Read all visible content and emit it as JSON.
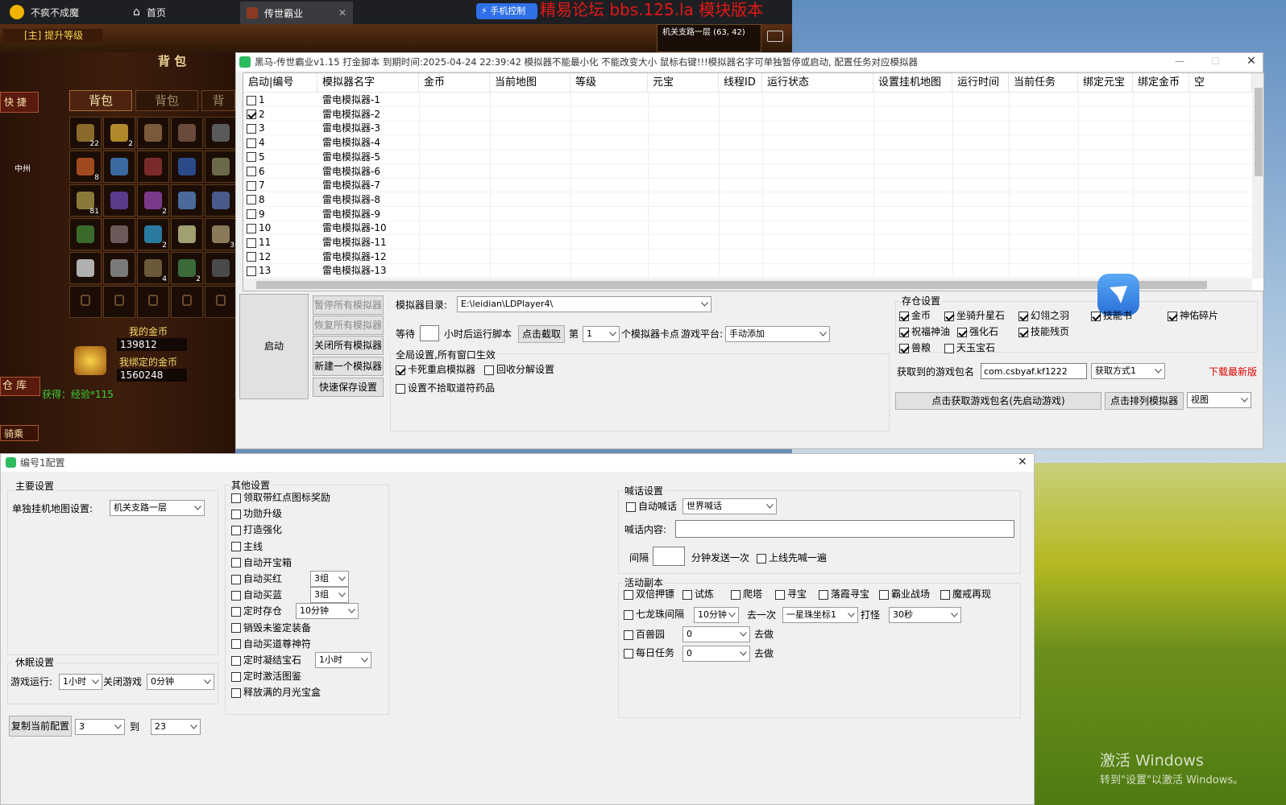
{
  "browser_tabs": {
    "tab1": "不疯不成魔",
    "tab2": "首页",
    "tab3": "传世霸业",
    "phone_control": "手机控制",
    "watermark": "精易论坛 bbs.125.la 模块版本"
  },
  "game": {
    "quest": "[主] 提升等级",
    "bag_title": "背 包",
    "quick": "快 捷",
    "tabs": [
      "背包",
      "背包",
      "背"
    ],
    "zhongzhou": "中州",
    "my_gold_label": "我的金币",
    "my_gold": "139812",
    "bound_gold_label": "我绑定的金币",
    "bound_gold": "1560248",
    "warehouse": "仓 库",
    "gain": "获得：经验*115",
    "mount": "骑乘",
    "map_info": "机关支路一层 (63, 42)",
    "item_counts": [
      "22",
      "2",
      "",
      "",
      "",
      "8",
      "",
      "",
      "",
      "",
      "81",
      "",
      "2",
      "",
      "",
      "",
      "",
      "2",
      "",
      "3",
      "",
      "",
      "4",
      "2",
      ""
    ]
  },
  "main_window": {
    "title": "黑马-传世霸业v1.15 打金脚本 到期时间:2025-04-24 22:39:42  模拟器不能最小化 不能改变大小 鼠标右键!!!模拟器名字可单独暂停或启动, 配置任务对应模拟器",
    "columns": [
      "启动|编号",
      "模拟器名字",
      "金币",
      "当前地图",
      "等级",
      "元宝",
      "线程ID",
      "运行状态",
      "设置挂机地图",
      "运行时间",
      "当前任务",
      "绑定元宝",
      "绑定金币",
      "空"
    ],
    "rows": [
      {
        "no": "1",
        "name": "雷电模拟器-1",
        "checked": false
      },
      {
        "no": "2",
        "name": "雷电模拟器-2",
        "checked": true
      },
      {
        "no": "3",
        "name": "雷电模拟器-3",
        "checked": false
      },
      {
        "no": "4",
        "name": "雷电模拟器-4",
        "checked": false
      },
      {
        "no": "5",
        "name": "雷电模拟器-5",
        "checked": false
      },
      {
        "no": "6",
        "name": "雷电模拟器-6",
        "checked": false
      },
      {
        "no": "7",
        "name": "雷电模拟器-7",
        "checked": false
      },
      {
        "no": "8",
        "name": "雷电模拟器-8",
        "checked": false
      },
      {
        "no": "9",
        "name": "雷电模拟器-9",
        "checked": false
      },
      {
        "no": "10",
        "name": "雷电模拟器-10",
        "checked": false
      },
      {
        "no": "11",
        "name": "雷电模拟器-11",
        "checked": false
      },
      {
        "no": "12",
        "name": "雷电模拟器-12",
        "checked": false
      },
      {
        "no": "13",
        "name": "雷电模拟器-13",
        "checked": false
      }
    ],
    "start": "启动",
    "pause_all": "暂停所有模拟器",
    "resume_all": "恢复所有模拟器",
    "close_all": "关闭所有模拟器",
    "new_one": "新建一个模拟器",
    "quick_save": "快速保存设置",
    "dir_label": "模拟器目录:",
    "dir_value": "E:\\leidian\\LDPlayer4\\",
    "wait_label": "等待",
    "wait_hours": "小时后运行脚本",
    "capture": "点击截取",
    "nth_label": "第",
    "nth_value": "1",
    "nth_suffix": "个模拟器卡点",
    "platform_label": "游戏平台:",
    "platform_value": "手动添加",
    "global_title": "全局设置,所有窗口生效",
    "g_restart": "卡死重启模拟器",
    "g_recycle": "回收分解设置",
    "g_nopick": "设置不拾取道符药品",
    "storage_title": "存仓设置",
    "storage": [
      {
        "label": "金币",
        "checked": true
      },
      {
        "label": "坐骑升星石",
        "checked": true
      },
      {
        "label": "幻翎之羽",
        "checked": true
      },
      {
        "label": "技能书",
        "checked": true
      },
      {
        "label": "神佑碎片",
        "checked": true
      },
      {
        "label": "祝福神油",
        "checked": true
      },
      {
        "label": "强化石",
        "checked": true
      },
      {
        "label": "技能残页",
        "checked": true
      },
      {
        "label": "兽粮",
        "checked": true
      },
      {
        "label": "天玉宝石",
        "checked": false
      }
    ],
    "pkg_label": "获取到的游戏包名",
    "pkg_value": "com.csbyaf.kf1222",
    "pkg_method": "获取方式1",
    "download": "下载最新版",
    "get_pkg": "点击获取游戏包名(先启动游戏)",
    "arrange": "点击排列模拟器",
    "view": "视图"
  },
  "config_window": {
    "title": "编号1配置",
    "main_title": "主要设置",
    "map_label": "单独挂机地图设置:",
    "map_value": "机关支路一层",
    "sleep_title": "休眠设置",
    "run_label": "游戏运行:",
    "run_value": "1小时",
    "close_label": "关闭游戏",
    "close_value": "0分钟",
    "copy_btn": "复制当前配置",
    "copy_from": "3",
    "to_label": "到",
    "copy_to": "23",
    "other_title": "其他设置",
    "other": [
      {
        "label": "领取带红点图标奖励",
        "sel": ""
      },
      {
        "label": "功勋升级",
        "sel": ""
      },
      {
        "label": "打造强化",
        "sel": ""
      },
      {
        "label": "主线",
        "sel": ""
      },
      {
        "label": "自动开宝箱",
        "sel": ""
      },
      {
        "label": "自动买红",
        "sel": "3组"
      },
      {
        "label": "自动买蓝",
        "sel": "3组"
      },
      {
        "label": "定时存仓",
        "sel": "10分钟"
      },
      {
        "label": "销毁未鉴定装备",
        "sel": ""
      },
      {
        "label": "自动买道尊神符",
        "sel": ""
      },
      {
        "label": "定时凝结宝石",
        "sel": "1小时"
      },
      {
        "label": "定时激活图鉴",
        "sel": ""
      },
      {
        "label": "释放满的月光宝盒",
        "sel": ""
      }
    ],
    "shout_title": "喊话设置",
    "auto_shout": "自动喊话",
    "shout_channel": "世界喊话",
    "shout_content_label": "喊话内容:",
    "interval_label": "间隔",
    "interval_suffix": "分钟发送一次",
    "online_shout": "上线先喊一遍",
    "activity_title": "活动副本",
    "act_row1": [
      "双倍押镖",
      "试炼",
      "爬塔",
      "寻宝",
      "落霞寻宝",
      "霸业战场",
      "魔戒再现"
    ],
    "dragon": "七龙珠间隔",
    "dragon_sel": "10分钟",
    "go_once": "去一次",
    "star": "一星珠坐标1",
    "fight": "打怪",
    "fight_sel": "30秒",
    "beast": "百兽园",
    "beast_sel": "0",
    "beast_go": "去做",
    "daily": "每日任务",
    "daily_sel": "0",
    "daily_go": "去做"
  },
  "desktop": {
    "activate1": "激活 Windows",
    "activate2": "转到\"设置\"以激活 Windows。"
  }
}
